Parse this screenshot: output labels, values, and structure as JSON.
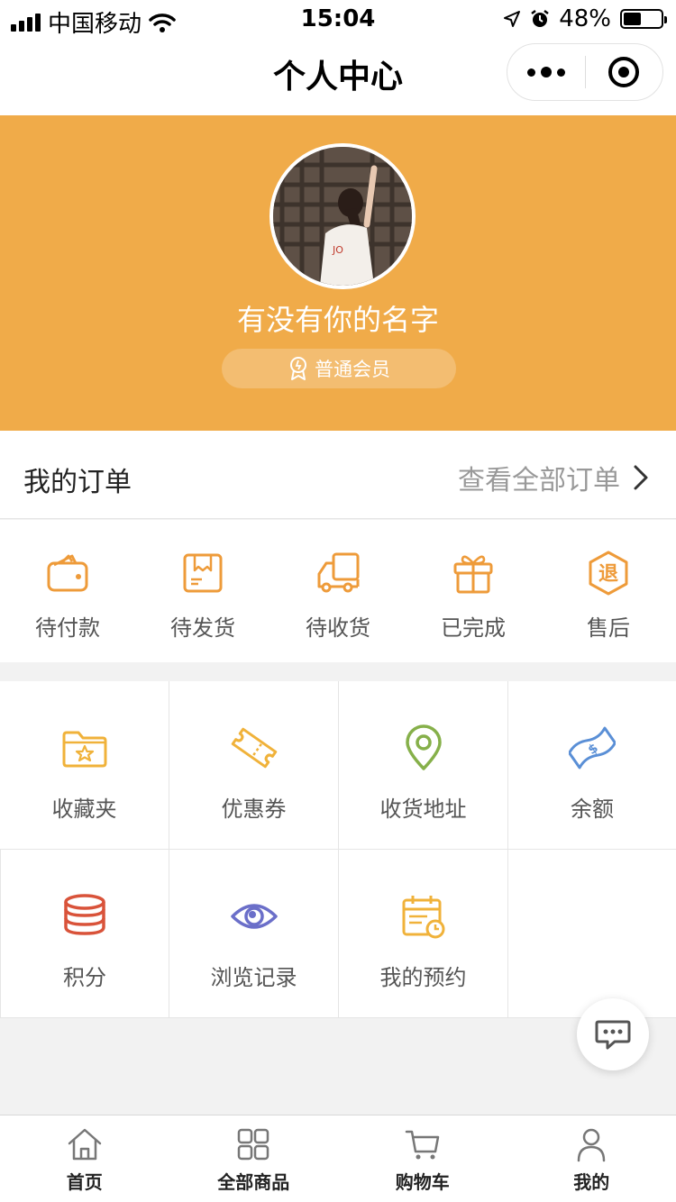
{
  "status_bar": {
    "carrier": "中国移动",
    "time": "15:04",
    "battery": "48%",
    "battery_level": 0.48
  },
  "nav": {
    "title": "个人中心"
  },
  "profile": {
    "username": "有没有你的名字",
    "member_level": "普通会员",
    "header_color": "#f0ab49"
  },
  "orders": {
    "title": "我的订单",
    "view_all": "查看全部订单",
    "items": [
      {
        "label": "待付款",
        "icon": "wallet-icon"
      },
      {
        "label": "待发货",
        "icon": "box-icon"
      },
      {
        "label": "待收货",
        "icon": "truck-icon"
      },
      {
        "label": "已完成",
        "icon": "gift-icon"
      },
      {
        "label": "售后",
        "icon": "refund-icon",
        "glyph": "退"
      }
    ]
  },
  "services": [
    {
      "label": "收藏夹",
      "icon": "folder-star-icon",
      "color": "#f0b23a"
    },
    {
      "label": "优惠券",
      "icon": "coupon-icon",
      "color": "#f0b23a"
    },
    {
      "label": "收货地址",
      "icon": "location-pin-icon",
      "color": "#86b04a"
    },
    {
      "label": "余额",
      "icon": "money-icon",
      "color": "#5a8fd6"
    },
    {
      "label": "积分",
      "icon": "coins-icon",
      "color": "#d9533a"
    },
    {
      "label": "浏览记录",
      "icon": "eye-icon",
      "color": "#6b6fc9"
    },
    {
      "label": "我的预约",
      "icon": "calendar-icon",
      "color": "#f0b23a"
    }
  ],
  "tab_bar": {
    "items": [
      {
        "label": "首页",
        "icon": "home-icon"
      },
      {
        "label": "全部商品",
        "icon": "grid-icon"
      },
      {
        "label": "购物车",
        "icon": "cart-icon"
      },
      {
        "label": "我的",
        "icon": "user-icon"
      }
    ]
  }
}
